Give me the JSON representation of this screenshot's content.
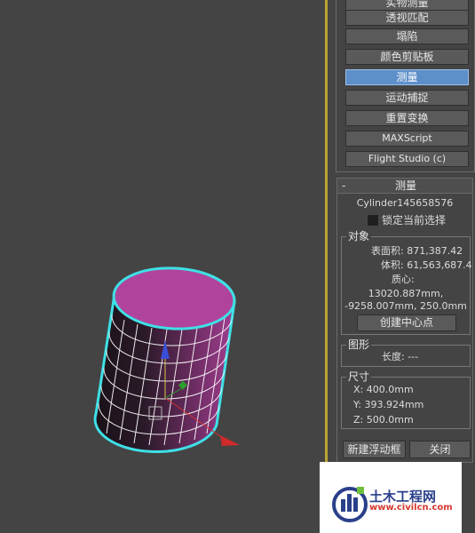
{
  "menu_buttons": [
    {
      "label": "实物测量"
    },
    {
      "label": "透视匹配"
    },
    {
      "label": "塌陷"
    },
    {
      "label": "颜色剪贴板"
    },
    {
      "label": "测量",
      "active": true
    },
    {
      "label": "运动捕捉"
    },
    {
      "label": "重置变换"
    },
    {
      "label": "MAXScript"
    },
    {
      "label": "Flight Studio (c)"
    }
  ],
  "measure": {
    "collapse_symbol": "-",
    "title": "测量",
    "object_name": "Cylinder145658576",
    "lock_label": "锁定当前选择",
    "object_group": {
      "legend": "对象",
      "surface_area": "表面积: 871,387.42",
      "volume": "体积: 61,563,687.4",
      "center_label": "质心:",
      "center_line1": "13020.887mm,",
      "center_line2": "-9258.007mm, 250.0mm",
      "create_center_button": "创建中心点"
    },
    "shape_group": {
      "legend": "图形",
      "length": "长度: ---"
    },
    "dimensions_group": {
      "legend": "尺寸",
      "x": "X:  400.0mm",
      "y": "Y:  393.924mm",
      "z": "Z:  500.0mm"
    },
    "new_floater_button": "新建浮动框",
    "close_button": "关闭"
  },
  "watermark": {
    "name": "土木工程网",
    "url": "www.civilcn.com"
  },
  "colors": {
    "accent": "#5d8fc9",
    "divider": "#b9a532",
    "cylinder": "#b0449c"
  }
}
